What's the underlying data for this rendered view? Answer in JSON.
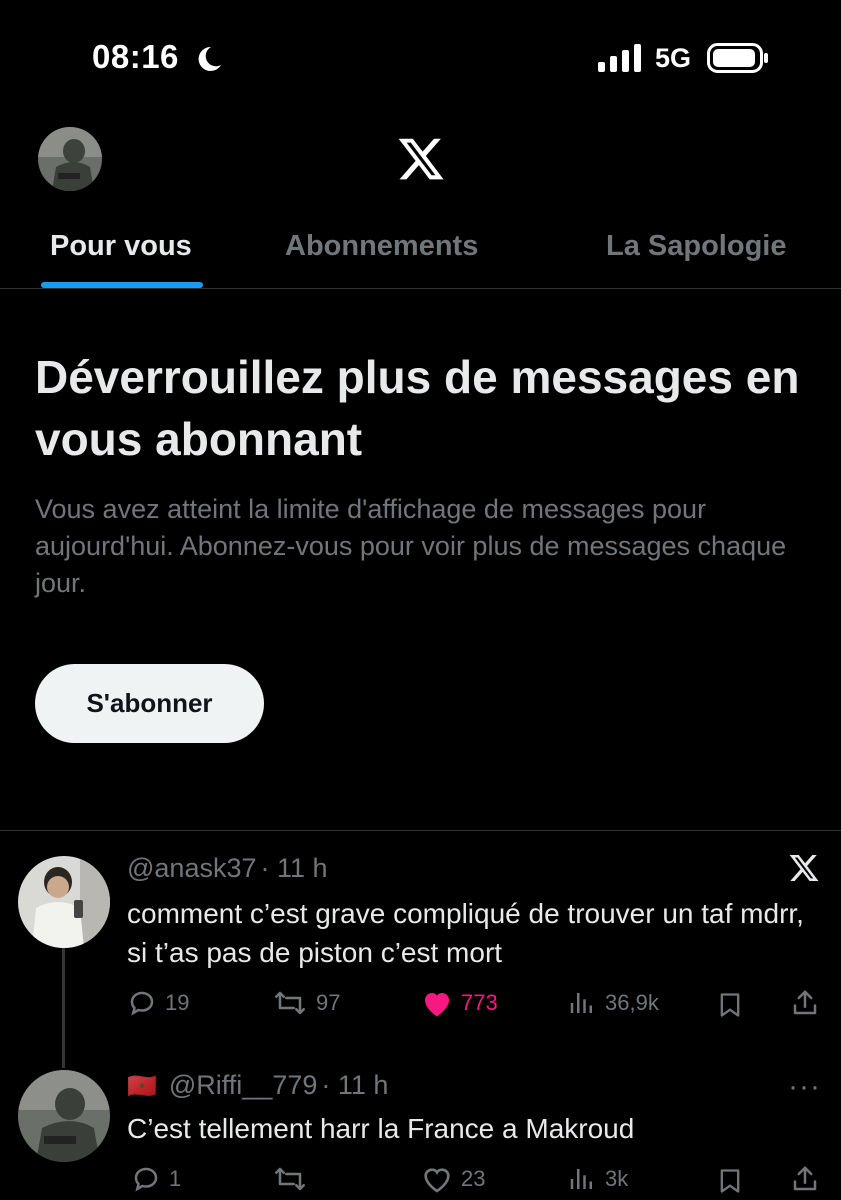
{
  "status_bar": {
    "time": "08:16",
    "network": "5G"
  },
  "header": {
    "app_logo": "x-logo"
  },
  "tabs": [
    {
      "label": "Pour vous",
      "active": true
    },
    {
      "label": "Abonnements",
      "active": false
    },
    {
      "label": "La Sapologie",
      "active": false
    }
  ],
  "upsell": {
    "title": "Déverrouillez plus de messages en vous abonnant",
    "text": "Vous avez atteint la limite d'affichage de messages pour aujourd'hui. Abonnez-vous pour voir plus de messages chaque jour.",
    "button_label": "S'abonner"
  },
  "posts": [
    {
      "handle": "@anask37",
      "time": "· 11 h",
      "text": "comment c’est grave compliqué de trouver un taf mdrr, si t’as pas de piston c’est mort",
      "replies": "19",
      "reposts": "97",
      "likes": "773",
      "views": "36,9k",
      "liked": true
    },
    {
      "flag": "🇲🇦",
      "handle": "@Riffi__779",
      "time": "· 11 h",
      "text": "C’est tellement harr la France a Makroud",
      "replies": "1",
      "reposts": "",
      "likes": "23",
      "views": "3k",
      "liked": false
    }
  ],
  "colors": {
    "accent": "#1d9bf0",
    "like": "#f91880",
    "muted": "#71767b",
    "background": "#000000"
  }
}
